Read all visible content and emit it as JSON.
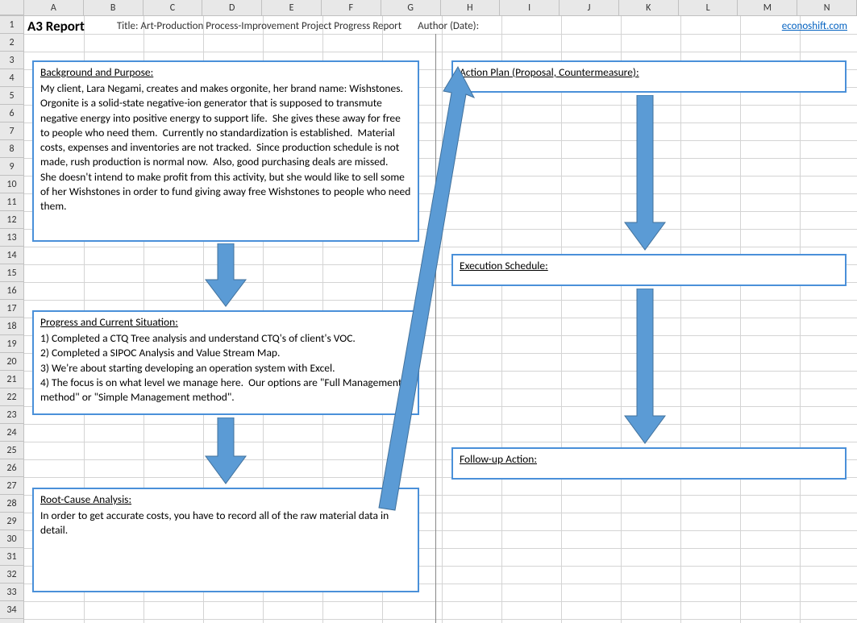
{
  "columns": [
    "A",
    "B",
    "C",
    "D",
    "E",
    "F",
    "G",
    "H",
    "I",
    "J",
    "K",
    "L",
    "M",
    "N"
  ],
  "rows": [
    "1",
    "2",
    "3",
    "4",
    "5",
    "6",
    "7",
    "8",
    "9",
    "10",
    "11",
    "12",
    "13",
    "14",
    "15",
    "16",
    "17",
    "18",
    "19",
    "20",
    "21",
    "22",
    "23",
    "24",
    "25",
    "26",
    "27",
    "28",
    "29",
    "30",
    "31",
    "32",
    "33",
    "34"
  ],
  "header": {
    "report_label": "A3 Report",
    "title": "Title: Art-Production Process-Improvement Project Progress Report",
    "author": "Author (Date):",
    "link": "econoshift.com"
  },
  "sections": {
    "background": {
      "title": "Background and Purpose:",
      "body": "My client, Lara Negami, creates and makes orgonite, her brand name: Wishstones.  Orgonite is a solid-state negative-ion generator that is supposed to transmute negative energy into positive energy to support life.  She gives these away for free to people who need them.  Currently no standardization is established.  Material costs, expenses and inventories are not tracked.  Since production schedule is not made, rush production is normal now.  Also, good purchasing deals are missed.\nShe doesn't intend to make profit from this activity, but she would like to sell some of her Wishstones in order to fund giving away free Wishstones to people who need them."
    },
    "progress": {
      "title": "Progress and Current Situation:",
      "body": "1) Completed a CTQ Tree analysis and understand CTQ's of client's VOC.\n2) Completed a SIPOC Analysis and Value Stream Map.\n3) We're about starting developing an operation system with Excel.\n4) The focus is on what level we manage here.  Our options are \"Full Management method\" or \"Simple Management method\"."
    },
    "rootcause": {
      "title": "Root-Cause Analysis:",
      "body": "In order to get accurate costs, you have to record all of the raw material data in detail."
    },
    "action": {
      "title": "Action Plan (Proposal, Countermeasure):",
      "body": ""
    },
    "schedule": {
      "title": "Execution Schedule:",
      "body": ""
    },
    "followup": {
      "title": "Follow-up Action:",
      "body": ""
    }
  }
}
